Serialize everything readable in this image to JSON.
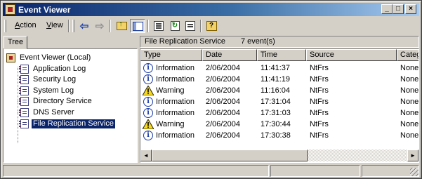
{
  "window": {
    "title": "Event Viewer",
    "min_glyph": "_",
    "max_glyph": "□",
    "close_glyph": "×"
  },
  "menu": {
    "action_prefix": "",
    "action_hotkey": "A",
    "action_rest": "ction",
    "view_prefix": "",
    "view_hotkey": "V",
    "view_rest": "iew"
  },
  "toolbar": {
    "back_glyph": "⇦",
    "forward_glyph": "⇨",
    "refresh_glyph": "↻",
    "help_glyph": "?"
  },
  "tree": {
    "tab_label": "Tree",
    "root": "Event Viewer (Local)",
    "items": [
      {
        "label": "Application Log"
      },
      {
        "label": "Security Log"
      },
      {
        "label": "System Log"
      },
      {
        "label": "Directory Service"
      },
      {
        "label": "DNS Server"
      },
      {
        "label": "File Replication Service"
      }
    ]
  },
  "list": {
    "header_title": "File Replication Service",
    "header_count": "7 event(s)",
    "columns": [
      "Type",
      "Date",
      "Time",
      "Source",
      "Categ"
    ],
    "rows": [
      {
        "type": "Information",
        "icon": "info-icon",
        "date": "2/06/2004",
        "time": "11:41:37",
        "source": "NtFrs",
        "category": "None"
      },
      {
        "type": "Information",
        "icon": "info-icon",
        "date": "2/06/2004",
        "time": "11:41:19",
        "source": "NtFrs",
        "category": "None"
      },
      {
        "type": "Warning",
        "icon": "warning-icon",
        "date": "2/06/2004",
        "time": "11:16:04",
        "source": "NtFrs",
        "category": "None"
      },
      {
        "type": "Information",
        "icon": "info-icon",
        "date": "2/06/2004",
        "time": "17:31:04",
        "source": "NtFrs",
        "category": "None"
      },
      {
        "type": "Information",
        "icon": "info-icon",
        "date": "2/06/2004",
        "time": "17:31:03",
        "source": "NtFrs",
        "category": "None"
      },
      {
        "type": "Warning",
        "icon": "warning-icon",
        "date": "2/06/2004",
        "time": "17:30:44",
        "source": "NtFrs",
        "category": "None"
      },
      {
        "type": "Information",
        "icon": "info-icon",
        "date": "2/06/2004",
        "time": "17:30:38",
        "source": "NtFrs",
        "category": "None"
      }
    ],
    "scroll_left_glyph": "◄",
    "scroll_right_glyph": "►"
  },
  "colors": {
    "title_start": "#0a246a",
    "title_end": "#a6caf0",
    "selection": "#0a246a",
    "face": "#d4d0c8"
  }
}
